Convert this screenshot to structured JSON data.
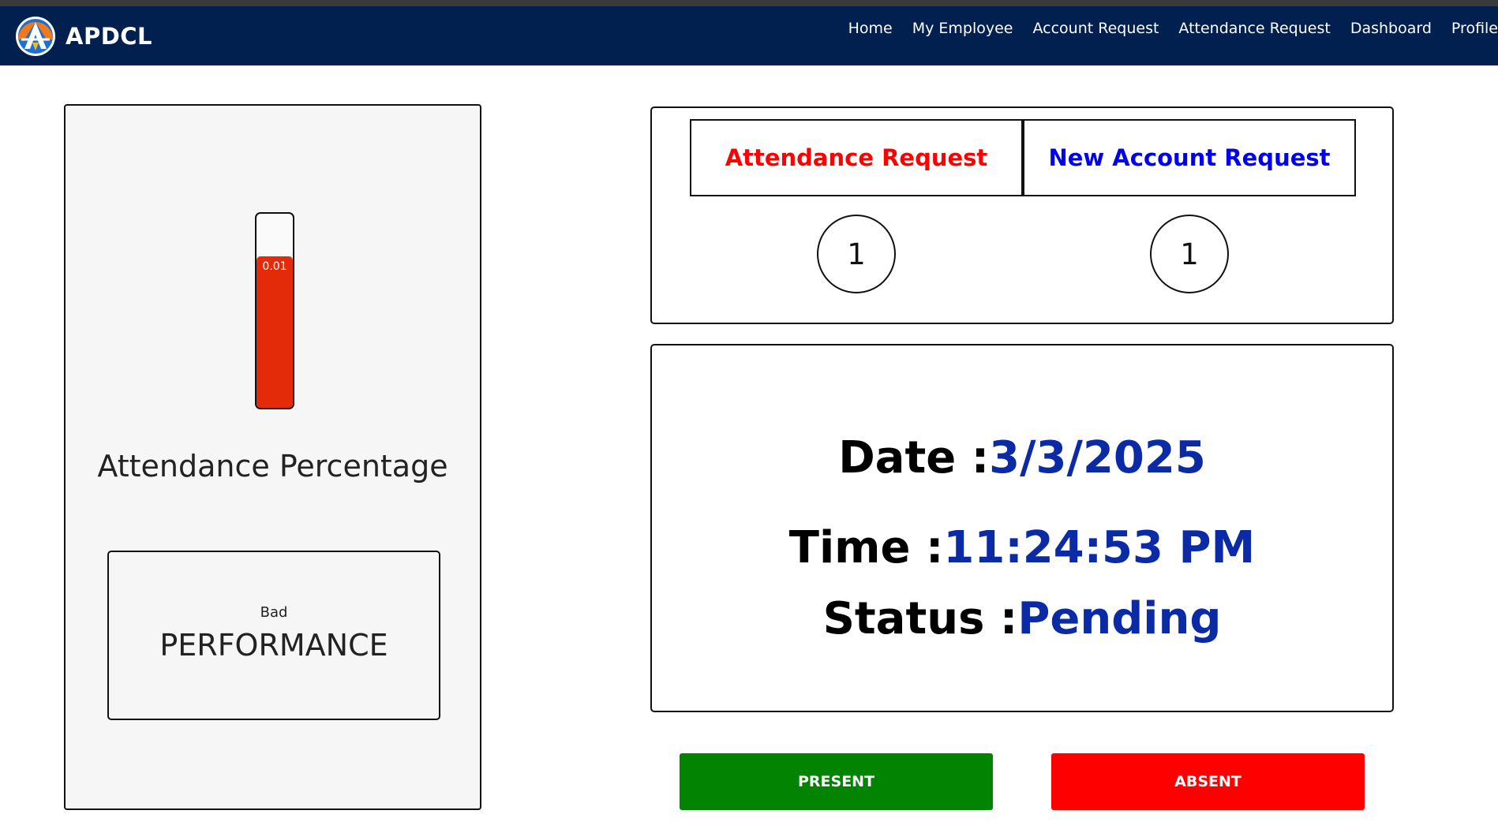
{
  "navbar": {
    "brand": "APDCL",
    "links": [
      "Home",
      "My Employee",
      "Account Request",
      "Attendance Request",
      "Dashboard",
      "Profile"
    ]
  },
  "attendance": {
    "percentage_label": "0.01",
    "fill_fraction": 0.78,
    "title": "Attendance Percentage",
    "performance_small": "Bad",
    "performance_big": "PERFORMANCE"
  },
  "requests": {
    "attendance_label": "Attendance Request",
    "attendance_count": "1",
    "account_label": "New Account Request",
    "account_count": "1"
  },
  "status": {
    "date_label": "Date :",
    "date_value": "3/3/2025",
    "time_label": "Time :",
    "time_value": "11:24:53 PM",
    "status_label": "Status :",
    "status_value": "Pending"
  },
  "actions": {
    "present": "PRESENT",
    "absent": "ABSENT"
  },
  "colors": {
    "navbar": "#02204f",
    "fill": "#e32b0a",
    "present": "#028302",
    "absent": "#ff0000",
    "value_blue": "#0a2aa6"
  }
}
